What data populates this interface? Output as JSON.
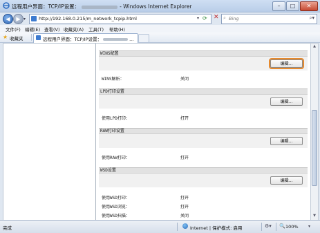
{
  "window": {
    "title_prefix": "远程用户界面：TCP/IP设置：",
    "title_suffix": "- Windows Internet Explorer",
    "min": "–",
    "max": "□",
    "close": "✕"
  },
  "address": {
    "url": "http://192.168.0.215/m_network_tcpip.html",
    "search_placeholder": "Bing"
  },
  "menu": [
    "文件(F)",
    "编辑(E)",
    "查看(V)",
    "收藏夹(A)",
    "工具(T)",
    "帮助(H)"
  ],
  "favorites": {
    "label": "收藏夹",
    "tab_title_prefix": "远程用户界面：TCP/IP设置：",
    "tab_title_suffix": "..."
  },
  "sections": [
    {
      "title": "WINS配置",
      "button": "编辑...",
      "rows": [
        {
          "label": "WINS解析：",
          "value": "关闭"
        }
      ]
    },
    {
      "title": "LPD打印设置",
      "button": "编辑...",
      "rows": [
        {
          "label": "使用LPD打印：",
          "value": "打开"
        }
      ]
    },
    {
      "title": "RAW打印设置",
      "button": "编辑...",
      "rows": [
        {
          "label": "使用RAW打印：",
          "value": "打开"
        }
      ]
    },
    {
      "title": "WSD设置",
      "button": "编辑...",
      "rows": [
        {
          "label": "使用WSD打印：",
          "value": "打开"
        },
        {
          "label": "使用WSD浏览：",
          "value": "打开"
        },
        {
          "label": "使用WSD扫描：",
          "value": "关闭"
        }
      ]
    }
  ],
  "status": {
    "left": "完成",
    "zone": "Internet | 保护模式: 启用",
    "zoom": "100%"
  },
  "colors": {
    "focus_ring": "#e68a2e",
    "section_header": "#e2e2e2"
  },
  "icons": [
    "ie-icon",
    "back-arrow-icon",
    "forward-arrow-icon",
    "refresh-icon",
    "stop-icon",
    "search-icon",
    "star-icon",
    "globe-icon",
    "zoom-icon"
  ]
}
